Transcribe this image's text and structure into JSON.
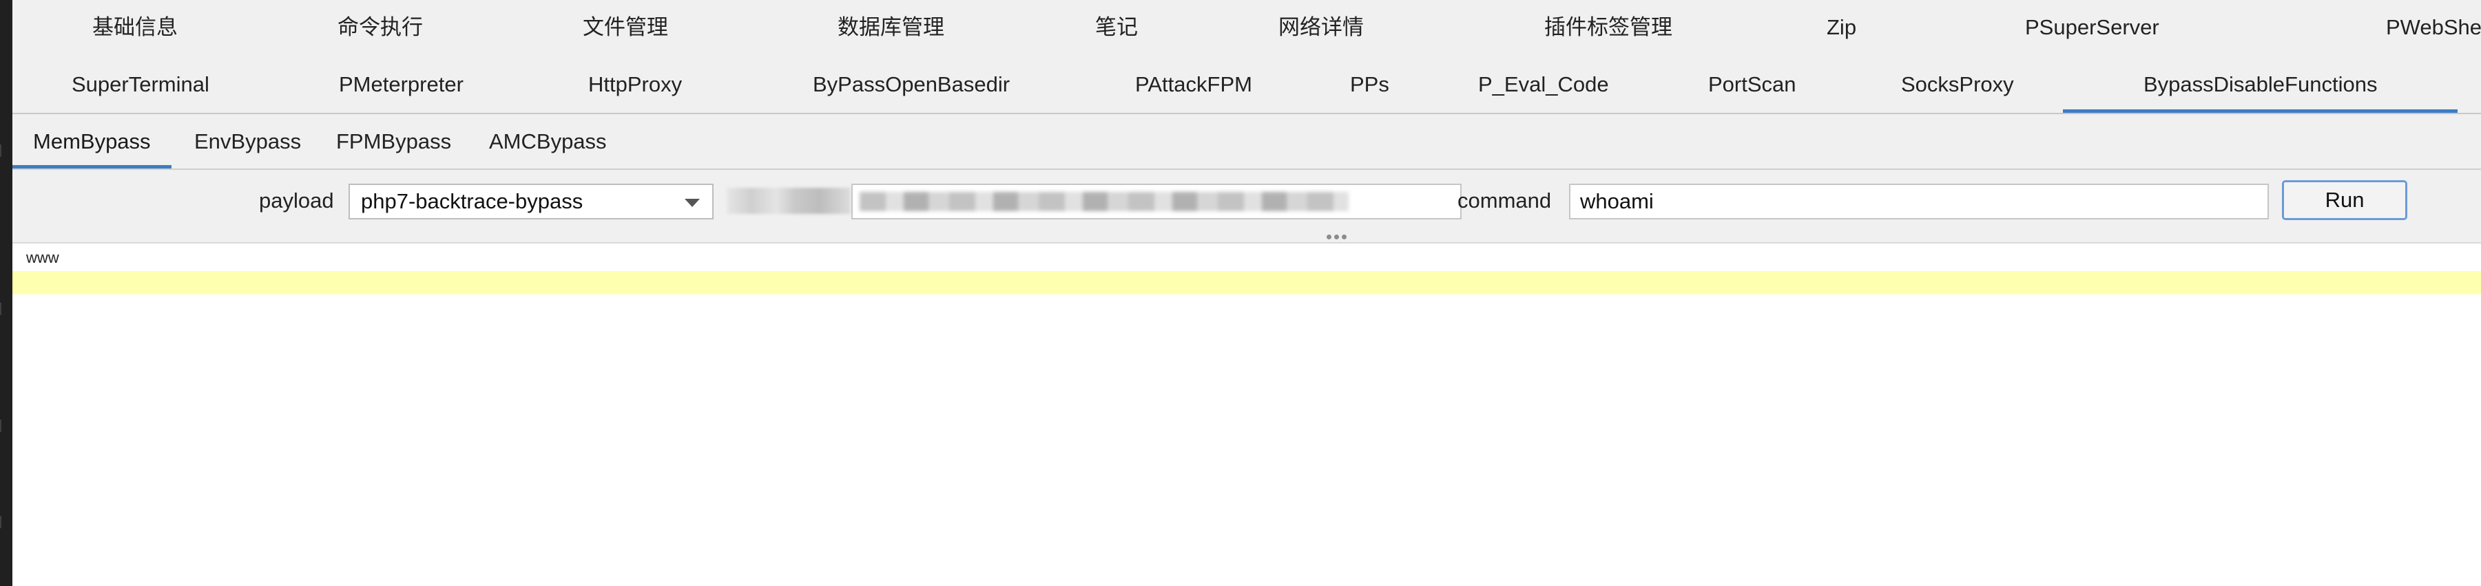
{
  "top_tabs_row1": [
    "基础信息",
    "命令执行",
    "文件管理",
    "数据库管理",
    "笔记",
    "网络详情",
    "插件标签管理",
    "Zip",
    "PSuperServer",
    "PWebShe"
  ],
  "top_tabs_row2": [
    "SuperTerminal",
    "PMeterpreter",
    "HttpProxy",
    "ByPassOpenBasedir",
    "PAttackFPM",
    "PPs",
    "P_Eval_Code",
    "PortScan",
    "SocksProxy",
    "BypassDisableFunctions"
  ],
  "active_top_tab": "BypassDisableFunctions",
  "sub_tabs": [
    "MemBypass",
    "EnvBypass",
    "FPMBypass",
    "AMCBypass"
  ],
  "active_sub_tab": "MemBypass",
  "toolbar": {
    "payload_label": "payload",
    "payload_value": "php7-backtrace-bypass",
    "command_label": "command",
    "command_value": "whoami",
    "run_label": "Run"
  },
  "output": {
    "lines": [
      "www"
    ]
  },
  "colors": {
    "accent": "#3c7dc3",
    "highlight_line": "#ffffb0",
    "window_bg": "#f0f0f0"
  }
}
